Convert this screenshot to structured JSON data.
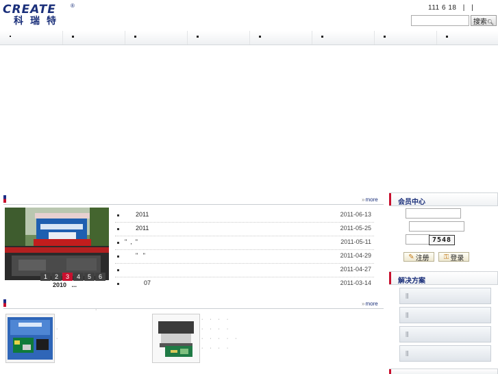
{
  "header": {
    "logo_text": "CREATE",
    "logo_reg": "®",
    "logo_cn": "科瑞特",
    "top_links": [
      "111 6 18",
      "|",
      "|"
    ],
    "search_placeholder": "",
    "search_button": "搜索"
  },
  "nav": {
    "items": [
      "",
      "",
      "",
      "",
      "",
      "",
      "",
      ""
    ]
  },
  "news": {
    "more_label": "more",
    "photo_caption": "2010   ...",
    "pages": [
      "1",
      "2",
      "3",
      "4",
      "5",
      "6"
    ],
    "active_page": "3",
    "items": [
      {
        "title": "2011",
        "date": "2011-06-13"
      },
      {
        "title": "2011",
        "date": "2011-05-25"
      },
      {
        "title": "\"  ,  \"",
        "date": "2011-05-11"
      },
      {
        "title": "\"   \"",
        "date": "2011-04-29"
      },
      {
        "title": "",
        "date": "2011-04-27"
      },
      {
        "title": "07",
        "date": "2011-03-14"
      }
    ]
  },
  "products": {
    "more_label": "more",
    "items": [
      {
        "name": "",
        "spec_lines": [
          "",
          "·",
          "·",
          "·"
        ]
      },
      {
        "name": "",
        "spec_lines": [
          "· · · ·",
          "· · · ·",
          "· · · · ·",
          "· · · ·"
        ]
      }
    ]
  },
  "member": {
    "title": "会员中心",
    "username_value": "",
    "password_value": "",
    "code_value": "",
    "captcha_text": "7548",
    "register_label": "注册",
    "login_label": "登录"
  },
  "solutions": {
    "title": "解决方案",
    "items": [
      "",
      "",
      "",
      ""
    ]
  },
  "colors": {
    "brand_blue": "#1a2f7a",
    "accent_red": "#c8102e"
  }
}
